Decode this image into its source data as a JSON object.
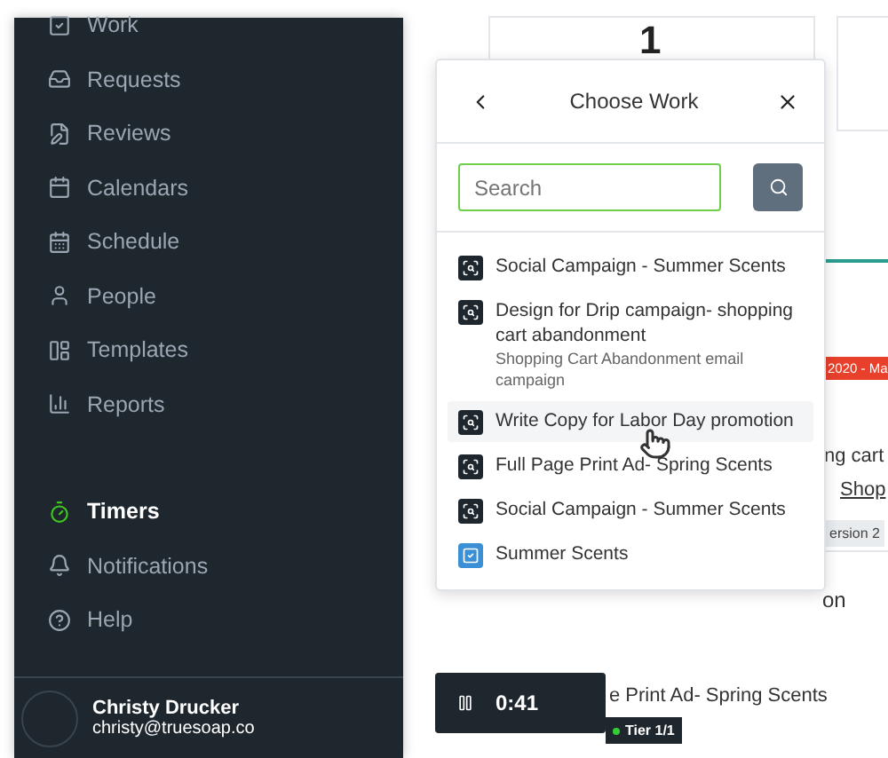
{
  "sidebar": {
    "items": [
      {
        "label": "Work",
        "active": false
      },
      {
        "label": "Requests",
        "active": false
      },
      {
        "label": "Reviews",
        "active": false
      },
      {
        "label": "Calendars",
        "active": false
      },
      {
        "label": "Schedule",
        "active": false
      },
      {
        "label": "People",
        "active": false
      },
      {
        "label": "Templates",
        "active": false
      },
      {
        "label": "Reports",
        "active": false
      }
    ],
    "lower_items": [
      {
        "label": "Timers",
        "active": true
      },
      {
        "label": "Notifications",
        "active": false
      },
      {
        "label": "Help",
        "active": false
      }
    ],
    "user": {
      "name": "Christy Drucker",
      "email": "christy@truesoap.co"
    }
  },
  "background": {
    "count": "1",
    "date_badge": "2020 - Ma",
    "text_1": "ng cart",
    "breadcrumb": "Shop",
    "version_badge": "ersion 2",
    "text_2": "on",
    "text_3": "e Print Ad- Spring Scents",
    "tier_badge": "Tier 1/1"
  },
  "popup": {
    "title": "Choose Work",
    "search": {
      "placeholder": "Search"
    },
    "items": [
      {
        "kind": "task",
        "title": "Social Campaign - Summer Scents",
        "hovered": false
      },
      {
        "kind": "task",
        "title": "Design for Drip campaign- shopping cart abandonment",
        "subtitle": "Shopping Cart Abandonment email campaign",
        "hovered": false
      },
      {
        "kind": "task",
        "title": "Write Copy for Labor Day promotion",
        "hovered": true
      },
      {
        "kind": "task",
        "title": "Full Page Print Ad- Spring Scents",
        "hovered": false
      },
      {
        "kind": "task",
        "title": "Social Campaign - Summer Scents",
        "hovered": false
      },
      {
        "kind": "project",
        "title": "Summer Scents",
        "hovered": false
      }
    ]
  },
  "timer": {
    "time": "0:41"
  }
}
